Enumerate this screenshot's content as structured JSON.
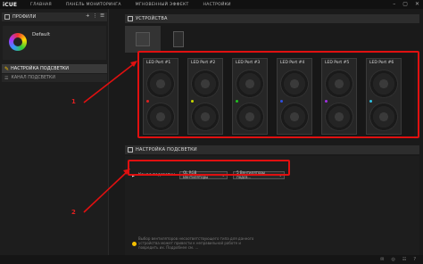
{
  "app": {
    "logo": "iCUE"
  },
  "menu": [
    "ГЛАВНАЯ",
    "ПАНЕЛЬ МОНИТОРИНГА",
    "МГНОВЕННЫЙ ЭФФЕКТ",
    "НАСТРОЙКИ"
  ],
  "window_controls": [
    "–",
    "▢",
    "✕"
  ],
  "left": {
    "profiles_title": "ПРОФИЛИ",
    "profile_tools": [
      "+",
      "⋮",
      "☰"
    ],
    "profile_name": "Default",
    "lighting_title": "НАСТРОЙКА ПОДСВЕТКИ",
    "channel_label": "КАНАЛ ПОДСВЕТКИ"
  },
  "right": {
    "devices_title": "УСТРОЙСТВА",
    "ports": [
      {
        "label": "LED Port #1",
        "led_color": "#e02020"
      },
      {
        "label": "LED Port #2",
        "led_color": "#c8d800"
      },
      {
        "label": "LED Port #3",
        "led_color": "#20c020"
      },
      {
        "label": "LED Port #4",
        "led_color": "#3050e0"
      },
      {
        "label": "LED Port #5",
        "led_color": "#a030e0"
      },
      {
        "label": "LED Port #6",
        "led_color": "#30c0e0"
      }
    ],
    "settings_title": "НАСТРОЙКА ПОДСВЕТКИ",
    "channel_label": "Канал подсветки",
    "dropdown1": "QL RGB Вентиляторы",
    "dropdown2": "5 Вентиляторы подсв...",
    "hint": "Выбор вентиляторов несоответствующего типа для данного устройства может привести к неправильной работе и повредить их. Подробнее см. ..."
  },
  "annotations": {
    "one": "1",
    "two": "2"
  },
  "colors": {
    "accent": "#f5c000",
    "annotation": "#e01010"
  }
}
